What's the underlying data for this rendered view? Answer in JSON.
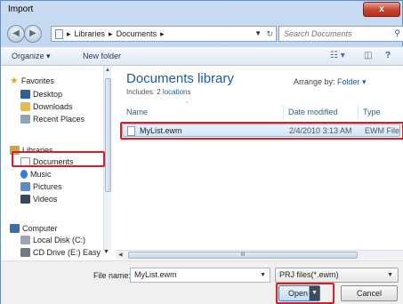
{
  "window": {
    "title": "Import",
    "close_glyph": "x"
  },
  "address": {
    "back_icon": "back-arrow-icon",
    "forward_icon": "forward-arrow-icon",
    "crumbs": [
      "Libraries",
      "Documents"
    ],
    "separator": "▸",
    "search_placeholder": "Search Documents"
  },
  "toolbar": {
    "organize": "Organize ▾",
    "new_folder": "New folder"
  },
  "nav": {
    "items": [
      {
        "label": "Favorites",
        "icon": "star-icon",
        "color": "#e2b016"
      },
      {
        "label": "Desktop",
        "icon": "desktop-icon",
        "color": "#2f5e9e"
      },
      {
        "label": "Downloads",
        "icon": "downloads-folder-icon",
        "color": "#e8b84a"
      },
      {
        "label": "Recent Places",
        "icon": "recent-places-icon",
        "color": "#8da3bb"
      },
      {
        "label": "Libraries",
        "icon": "libraries-icon",
        "color": "#c9a44c"
      },
      {
        "label": "Documents",
        "icon": "documents-icon",
        "color": "#d6dbe3"
      },
      {
        "label": "Music",
        "icon": "music-icon",
        "color": "#3a7bd5"
      },
      {
        "label": "Pictures",
        "icon": "pictures-icon",
        "color": "#5b8bc4"
      },
      {
        "label": "Videos",
        "icon": "videos-icon",
        "color": "#34495e"
      },
      {
        "label": "Computer",
        "icon": "computer-icon",
        "color": "#3d6ea8"
      },
      {
        "label": "Local Disk (C:)",
        "icon": "disk-icon",
        "color": "#9aa6b5"
      },
      {
        "label": "CD Drive (E:) Easy",
        "icon": "cd-drive-icon",
        "color": "#6c7a8c"
      }
    ]
  },
  "content": {
    "title": "Documents library",
    "includes_prefix": "Includes: ",
    "includes_link": "2 locations",
    "arrange_label": "Arrange by:",
    "arrange_value": "Folder ▾",
    "columns": [
      "Name",
      "Date modified",
      "Type"
    ],
    "files": [
      {
        "name": "MyList.ewm",
        "date": "2/4/2010 3:13 AM",
        "type": "EWM File"
      }
    ],
    "hscroll_grip": "III"
  },
  "footer": {
    "file_name_label": "File name:",
    "file_name_value": "MyList.ewm",
    "file_type": "PRJ files(*.ewm)",
    "open": "Open",
    "cancel": "Cancel"
  },
  "colors": {
    "highlight_red": "#d3202a",
    "link_blue": "#1e5b9e"
  }
}
